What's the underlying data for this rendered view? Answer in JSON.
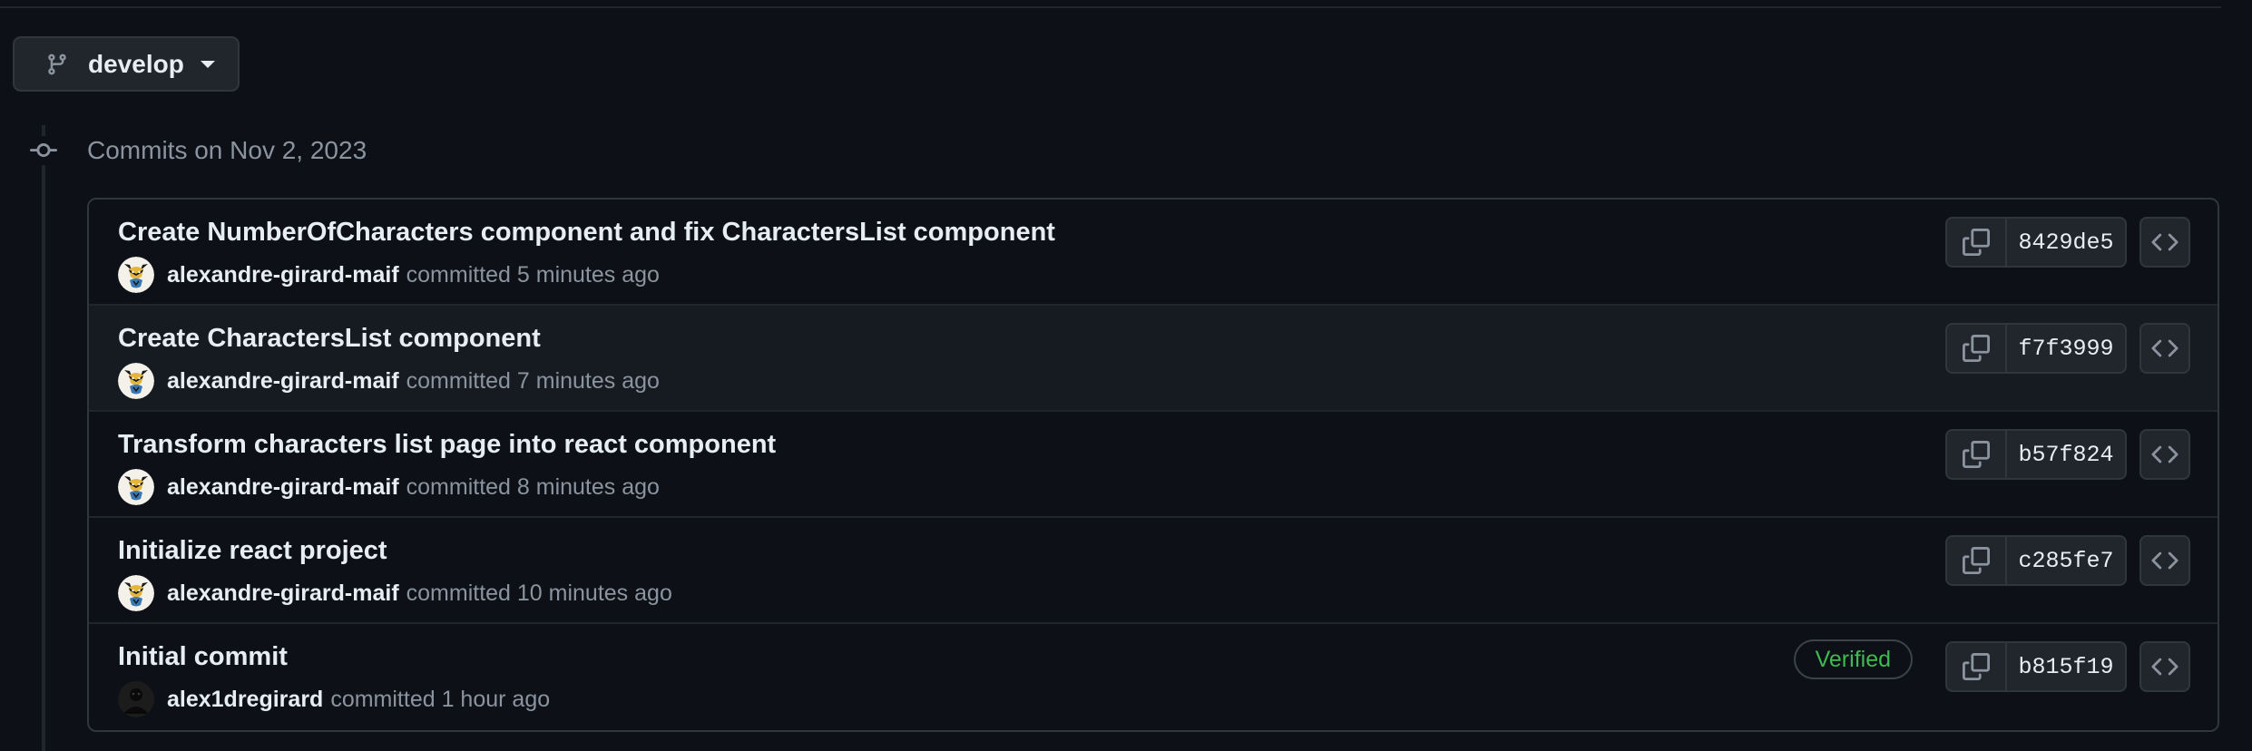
{
  "branch": {
    "name": "develop",
    "icon": "git-branch-icon"
  },
  "timeline": {
    "date_heading": "Commits on Nov 2, 2023",
    "icon": "git-commit-icon"
  },
  "commits": [
    {
      "title": "Create NumberOfCharacters component and fix CharactersList component",
      "author": "alexandre-girard-maif",
      "committed": "committed 5 minutes ago",
      "sha": "8429de5",
      "verified": ""
    },
    {
      "title": "Create CharactersList component",
      "author": "alexandre-girard-maif",
      "committed": "committed 7 minutes ago",
      "sha": "f7f3999",
      "verified": ""
    },
    {
      "title": "Transform characters list page into react component",
      "author": "alexandre-girard-maif",
      "committed": "committed 8 minutes ago",
      "sha": "b57f824",
      "verified": ""
    },
    {
      "title": "Initialize react project",
      "author": "alexandre-girard-maif",
      "committed": "committed 10 minutes ago",
      "sha": "c285fe7",
      "verified": ""
    },
    {
      "title": "Initial commit",
      "author": "alex1dregirard",
      "committed": "committed 1 hour ago",
      "sha": "b815f19",
      "verified": "Verified"
    }
  ],
  "colors": {
    "background": "#0d1117",
    "row_highlight": "#161b22",
    "border": "#30363d",
    "muted_text": "#8b949e",
    "verified_green": "#3fb950"
  }
}
